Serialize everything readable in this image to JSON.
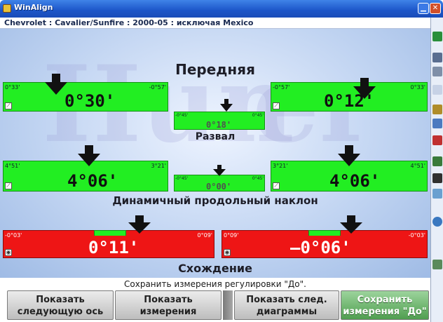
{
  "window": {
    "title": "WinAlign",
    "minimize_icon": "minimize-icon",
    "close_icon": "close-icon"
  },
  "vehicle": "Chevrolet : Cavalier/Sunfire : 2000-05 : исключая Mexico",
  "sections": {
    "front": "Передняя",
    "camber": "Развал",
    "caster": "Динамичный продольный наклон",
    "toe": "Схождение"
  },
  "camber": {
    "left": {
      "min": "0°33'",
      "max": "-0°57'",
      "value": "0°30'"
    },
    "cross": {
      "min": "-0°45'",
      "max": "0°45'",
      "value": "0°18'"
    },
    "right": {
      "min": "-0°57'",
      "max": "0°33'",
      "value": "0°12'"
    }
  },
  "caster": {
    "left": {
      "min": "4°51'",
      "max": "3°21'",
      "value": "4°06'"
    },
    "cross": {
      "min": "-0°45'",
      "max": "0°45'",
      "value": "0°00'"
    },
    "right": {
      "min": "3°21'",
      "max": "4°51'",
      "value": "4°06'"
    }
  },
  "toe": {
    "left": {
      "min": "-0°03'",
      "max": "0°09'",
      "value": "0°11'"
    },
    "right": {
      "min": "0°09'",
      "max": "-0°03'",
      "value": "–0°06'"
    }
  },
  "status": "Сохранить измерения регулировки \"До\".",
  "buttons": {
    "next_axle": "Показать следующую ось",
    "show_measurements": "Показать измерения",
    "next_diagrams": "Показать след. диаграммы",
    "save_before": "Сохранить измерения \"До\""
  },
  "colors": {
    "in_spec": "#22ee22",
    "out_of_spec": "#ee1515",
    "accent": "#1c55c8"
  },
  "sidebar_icons": [
    "tools-icon",
    "monitor-icon",
    "print-icon",
    "specs-icon",
    "wrench-icon",
    "gauge-icon",
    "chart-icon",
    "vehicle-icon",
    "flag-icon",
    "help-icon",
    "globe-icon",
    "link-icon"
  ]
}
